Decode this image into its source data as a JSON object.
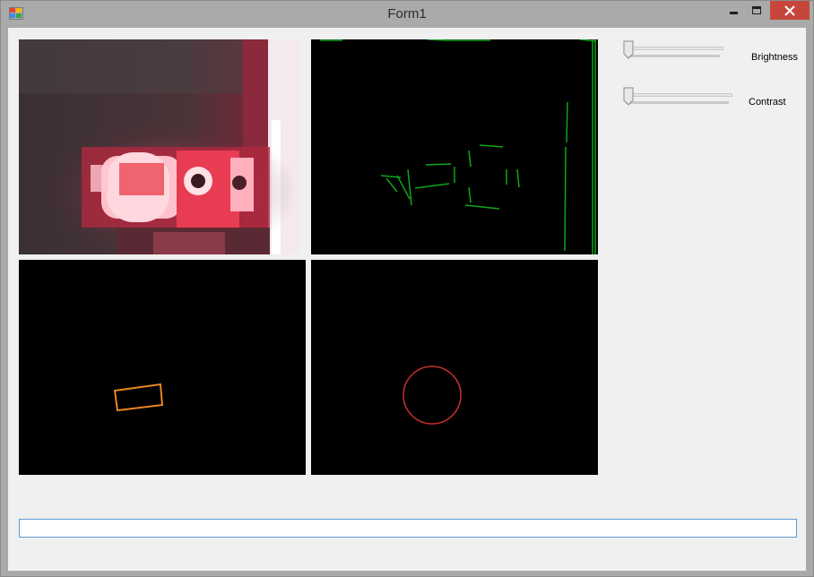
{
  "window": {
    "title": "Form1"
  },
  "controls": {
    "brightness": {
      "label": "Brightness",
      "value_fraction": 0.0
    },
    "contrast": {
      "label": "Contrast",
      "value_fraction": 0.0
    }
  },
  "panes": [
    {
      "name": "camera-feed",
      "content": "camera image"
    },
    {
      "name": "edge-lines",
      "content": "green line segments"
    },
    {
      "name": "rectangle-detection",
      "content": "orange rotated rectangle"
    },
    {
      "name": "circle-detection",
      "content": "red circle"
    }
  ],
  "status": {
    "value": ""
  },
  "colors": {
    "edge_lines": "#0fa51a",
    "rectangle": "#e8861f",
    "circle": "#c8302c",
    "close_button": "#c7463b",
    "status_border": "#5b9bd5"
  }
}
